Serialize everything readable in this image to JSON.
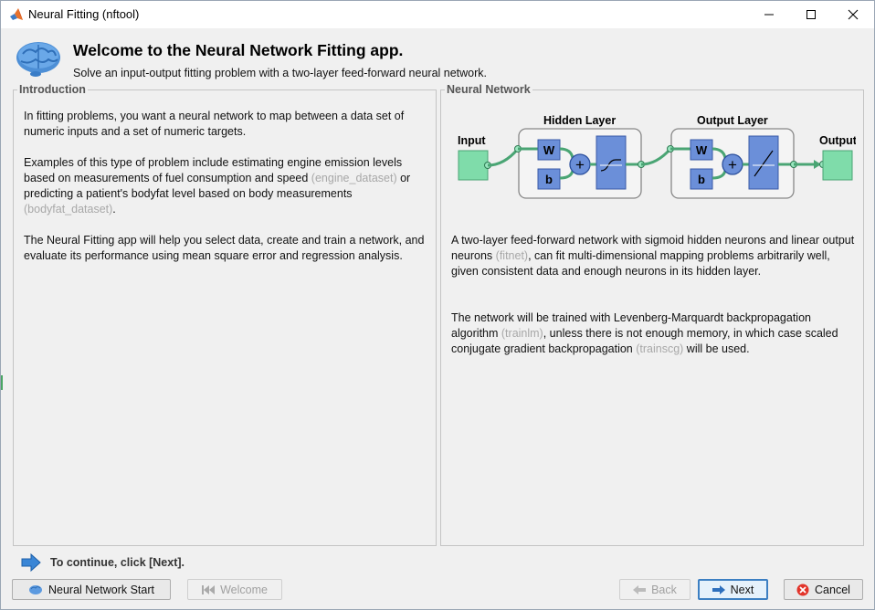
{
  "window": {
    "title": "Neural Fitting (nftool)",
    "minimize_label": "Minimize",
    "maximize_label": "Maximize",
    "close_label": "Close"
  },
  "header": {
    "title": "Welcome to the Neural Network Fitting app.",
    "subtitle": "Solve an input-output fitting problem with a two-layer feed-forward neural network."
  },
  "introduction": {
    "legend": "Introduction",
    "p1": "In fitting problems, you want a neural network to map between a data set of numeric inputs and a set of numeric targets.",
    "p2_a": "Examples of this type of problem include estimating engine emission levels based on measurements of fuel consumption and speed ",
    "p2_link1": "(engine_dataset)",
    "p2_b": " or predicting a patient's bodyfat level based on body measurements ",
    "p2_link2": "(bodyfat_dataset)",
    "p2_c": ".",
    "p3": "The Neural Fitting app will help you select data, create and train a network, and evaluate its performance using mean square error and regression analysis."
  },
  "neural_network": {
    "legend": "Neural Network",
    "diagram": {
      "input_label": "Input",
      "hidden_label": "Hidden Layer",
      "output_layer_label": "Output Layer",
      "output_label": "Output",
      "weight_label": "W",
      "bias_label": "b",
      "sum_symbol": "+"
    },
    "p1_a": "A two-layer feed-forward network with sigmoid hidden neurons and linear output neurons ",
    "p1_link": "(fitnet)",
    "p1_b": ", can fit multi-dimensional mapping problems arbitrarily well, given consistent data and enough neurons in its hidden layer.",
    "p2_a": "The network will be trained with Levenberg-Marquardt backpropagation algorithm ",
    "p2_link1": "(trainlm)",
    "p2_b": ", unless there is not enough memory, in which case scaled conjugate gradient backpropagation ",
    "p2_link2": "(trainscg)",
    "p2_c": " will be used."
  },
  "footer": {
    "continue_text": "To continue, click [Next].",
    "nn_start_label": "Neural Network Start",
    "welcome_label": "Welcome",
    "back_label": "Back",
    "next_label": "Next",
    "cancel_label": "Cancel"
  },
  "colors": {
    "accent_blue": "#3c7fc2",
    "layer_blue": "#6b8fd9",
    "io_green": "#7fdcaa",
    "link_gray": "#a8a8a8"
  }
}
